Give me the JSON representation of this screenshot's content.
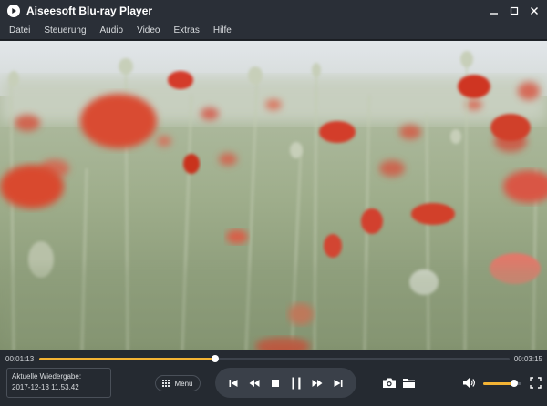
{
  "window": {
    "title": "Aiseesoft Blu-ray Player"
  },
  "menu": {
    "items": [
      {
        "label": "Datei"
      },
      {
        "label": "Steuerung"
      },
      {
        "label": "Audio"
      },
      {
        "label": "Video"
      },
      {
        "label": "Extras"
      },
      {
        "label": "Hilfe"
      }
    ]
  },
  "playback": {
    "elapsed": "00:01:13",
    "total": "00:03:15",
    "progress_fraction": 0.374
  },
  "info": {
    "line1": "Aktuelle Wiedergabe:",
    "line2": "2017-12-13 11.53.42"
  },
  "controls": {
    "menu_label": "Menü",
    "volume_fraction": 0.8
  },
  "colors": {
    "accent": "#f3b334",
    "titlebar": "#2a2f37",
    "controlbar": "#252a31"
  }
}
